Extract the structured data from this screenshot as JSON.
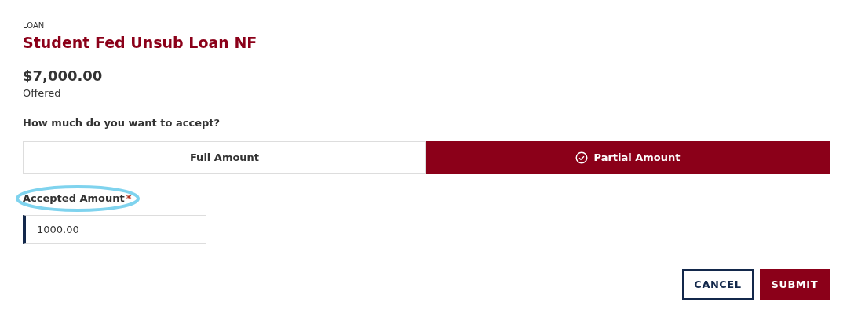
{
  "eyebrow": "LOAN",
  "title": "Student Fed Unsub Loan NF",
  "amount": "$7,000.00",
  "amount_label": "Offered",
  "question": "How much do you want to accept?",
  "options": [
    {
      "label": "Full Amount",
      "selected": false
    },
    {
      "label": "Partial Amount",
      "selected": true
    }
  ],
  "field": {
    "label": "Accepted Amount",
    "required_mark": "*",
    "value": "1000.00",
    "highlighted": true
  },
  "buttons": [
    {
      "label": "CANCEL",
      "kind": "secondary"
    },
    {
      "label": "SUBMIT",
      "kind": "primary"
    }
  ]
}
